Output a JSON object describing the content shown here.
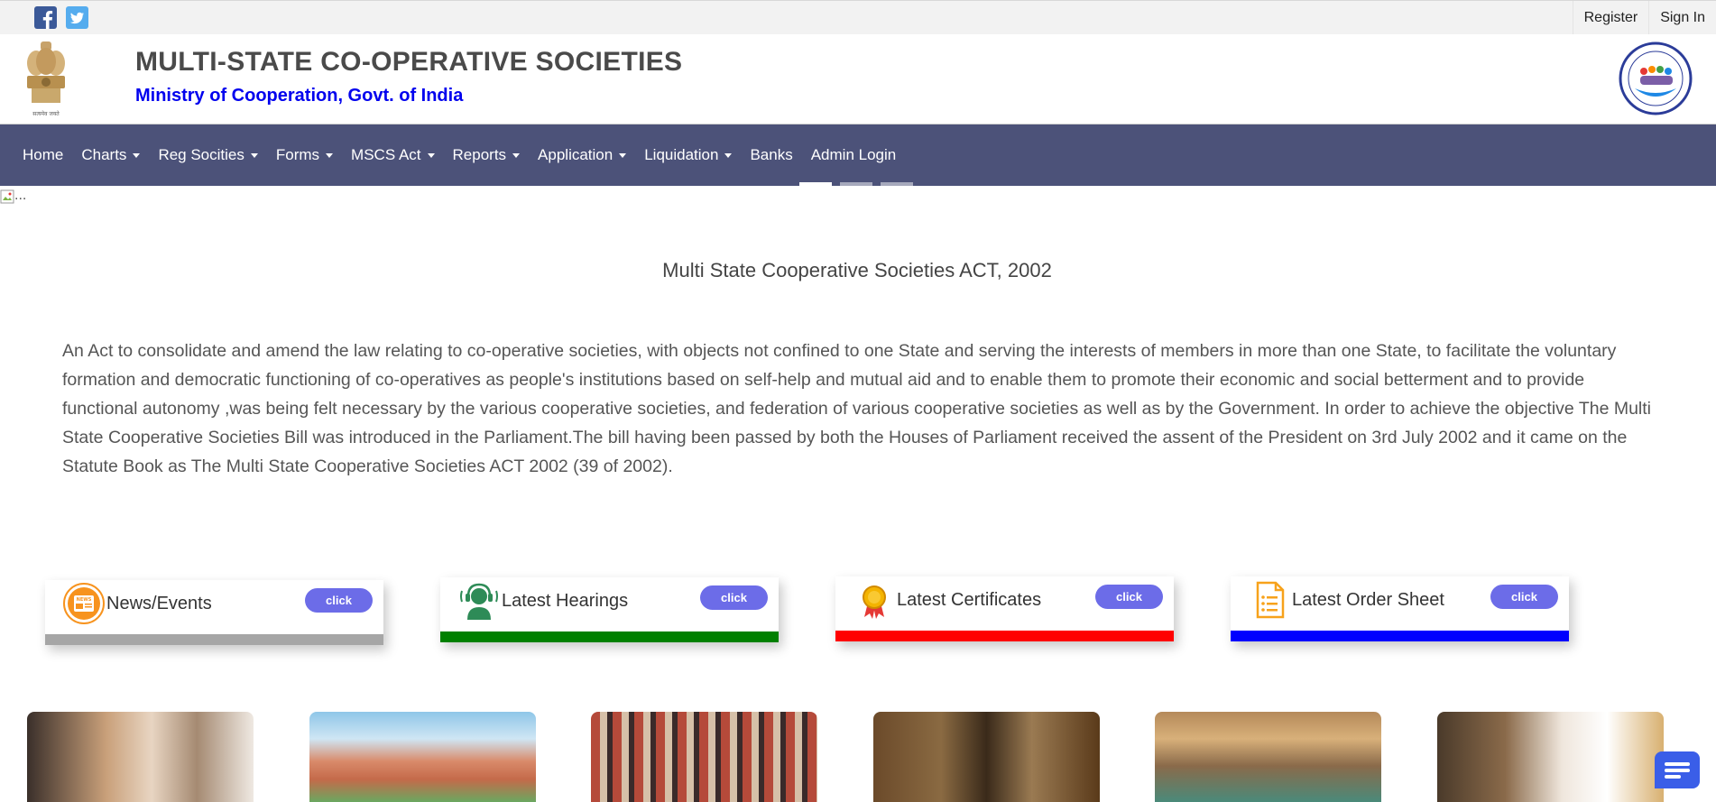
{
  "topbar": {
    "social": [
      {
        "name": "facebook-icon",
        "color": "#3b5998"
      },
      {
        "name": "twitter-icon",
        "color": "#55acee"
      }
    ],
    "register_label": "Register",
    "signin_label": "Sign In"
  },
  "header": {
    "title": "MULTI-STATE CO-OPERATIVE SOCIETIES",
    "subtitle": "Ministry of Cooperation, Govt. of India",
    "emblem_text": "सत्यमेव जयते",
    "logo_text": "Multi State Cooperative Societies (MSCS)"
  },
  "nav": {
    "items": [
      {
        "label": "Home",
        "dropdown": false
      },
      {
        "label": "Charts",
        "dropdown": true
      },
      {
        "label": "Reg Socities",
        "dropdown": true
      },
      {
        "label": "Forms",
        "dropdown": true
      },
      {
        "label": "MSCS Act",
        "dropdown": true
      },
      {
        "label": "Reports",
        "dropdown": true
      },
      {
        "label": "Application",
        "dropdown": true
      },
      {
        "label": "Liquidation",
        "dropdown": true
      },
      {
        "label": "Banks",
        "dropdown": false
      },
      {
        "label": "Admin Login",
        "dropdown": false
      }
    ]
  },
  "carousel": {
    "alt_text": "..."
  },
  "act": {
    "title": "Multi State Cooperative Societies ACT, 2002",
    "body": "An Act to consolidate and amend the law relating to co-operative societies, with objects not confined to one State and serving the interests of members in more than one State, to facilitate the voluntary formation and democratic functioning of co-operatives as people's institutions based on self-help and mutual aid and to enable them to promote their economic and social betterment and to provide functional autonomy ,was being felt necessary by the various cooperative societies, and federation of various cooperative societies as well as by the Government. In order to achieve the objective The Multi State Cooperative Societies Bill was introduced in the Parliament.The bill having been passed by both the Houses of Parliament received the assent of the President on 3rd July 2002 and it came on the Statute Book as The Multi State Cooperative Societies ACT 2002 (39 of 2002)."
  },
  "cards": [
    {
      "title": "News/Events",
      "button": "click",
      "bar_color": "#a6a6a6",
      "icon": "news-icon"
    },
    {
      "title": "Latest Hearings",
      "button": "click",
      "bar_color": "#008000",
      "icon": "headset-icon"
    },
    {
      "title": "Latest Certificates",
      "button": "click",
      "bar_color": "#ff0000",
      "icon": "award-icon"
    },
    {
      "title": "Latest Order Sheet",
      "button": "click",
      "bar_color": "#0000ff",
      "icon": "document-icon"
    }
  ],
  "gallery": {
    "photos": [
      {
        "name": "photo-leaders"
      },
      {
        "name": "photo-parliament-building"
      },
      {
        "name": "photo-auditorium"
      },
      {
        "name": "photo-ceremony"
      },
      {
        "name": "photo-hall-interior"
      },
      {
        "name": "photo-speaker"
      }
    ]
  },
  "chat": {
    "icon": "chat-icon",
    "color": "#3a5ee8"
  }
}
